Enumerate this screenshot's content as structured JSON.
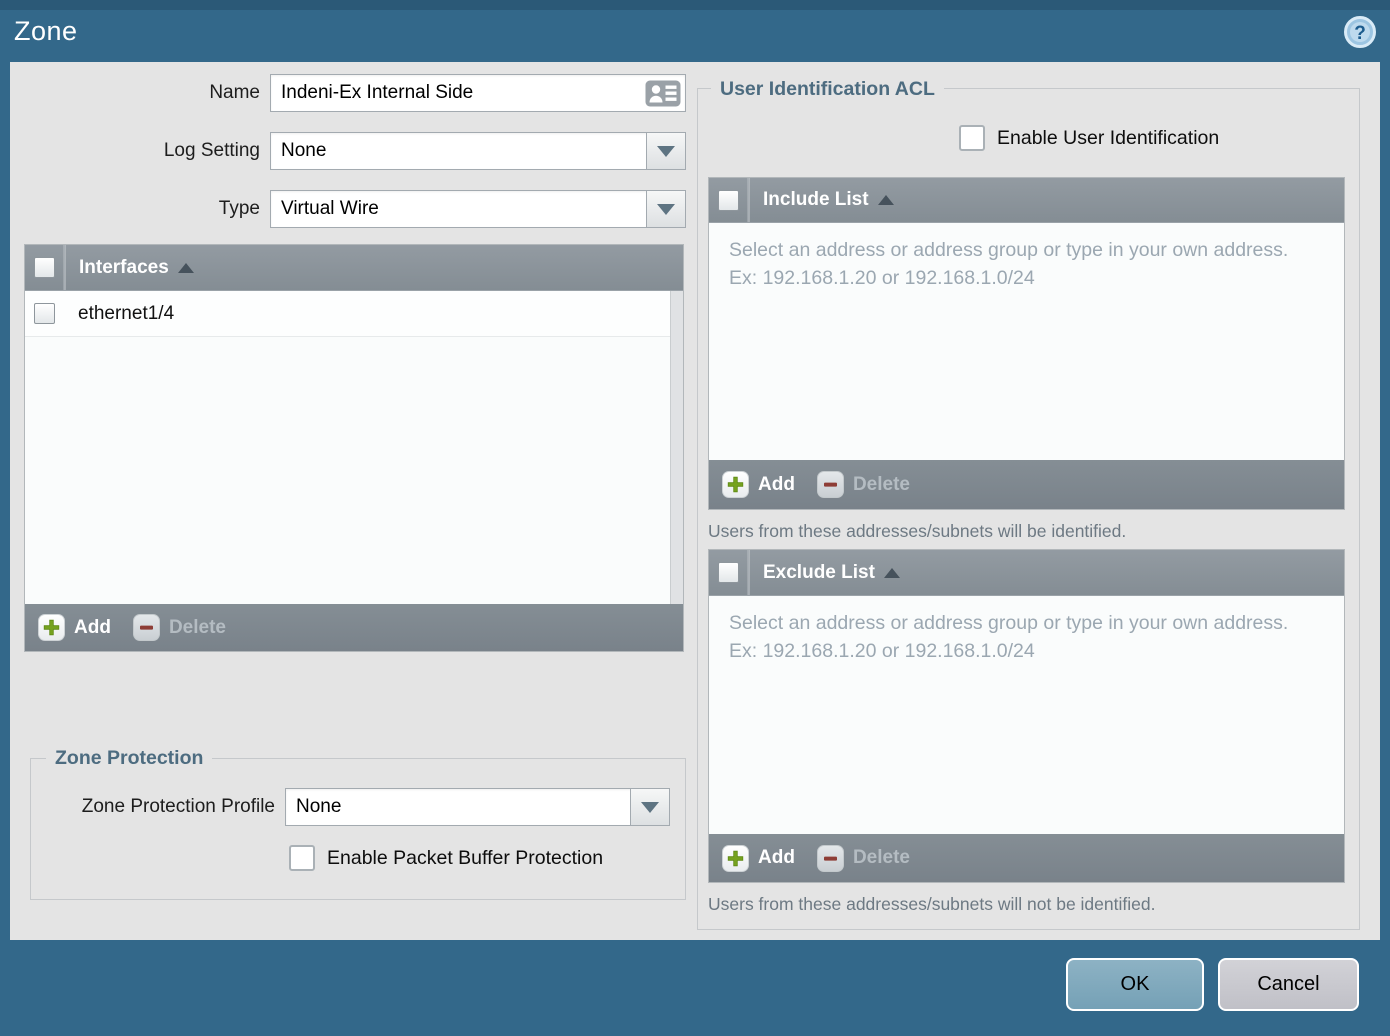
{
  "dialog": {
    "title": "Zone"
  },
  "form": {
    "name": {
      "label": "Name",
      "value": "Indeni-Ex Internal Side"
    },
    "log_setting": {
      "label": "Log Setting",
      "value": "None"
    },
    "type": {
      "label": "Type",
      "value": "Virtual Wire"
    }
  },
  "interfaces": {
    "header": "Interfaces",
    "rows": [
      "ethernet1/4"
    ],
    "add_label": "Add",
    "delete_label": "Delete"
  },
  "zone_protection": {
    "legend": "Zone Protection",
    "profile_label": "Zone Protection Profile",
    "profile_value": "None",
    "packet_buffer_label": "Enable Packet Buffer Protection"
  },
  "user_identification": {
    "legend": "User Identification ACL",
    "enable_label": "Enable User Identification",
    "include": {
      "header": "Include List",
      "placeholder": "Select an address or address group or type in your own address. Ex: 192.168.1.20 or 192.168.1.0/24",
      "add_label": "Add",
      "delete_label": "Delete",
      "hint": "Users from these addresses/subnets will be identified."
    },
    "exclude": {
      "header": "Exclude List",
      "placeholder": "Select an address or address group or type in your own address. Ex: 192.168.1.20 or 192.168.1.0/24",
      "add_label": "Add",
      "delete_label": "Delete",
      "hint": "Users from these addresses/subnets will not be identified."
    }
  },
  "footer": {
    "ok_label": "OK",
    "cancel_label": "Cancel"
  },
  "colors": {
    "titlebar": "#33688a",
    "panel": "#e4e4e4",
    "table_header": "#8a9298",
    "toolbar": "#7f888e",
    "ok_button": "#7ea8bc",
    "cancel_button": "#c9c9ce",
    "add_plus": "#76a21f",
    "delete_minus": "#8e3d36",
    "placeholder_text": "#9ba7b1"
  }
}
